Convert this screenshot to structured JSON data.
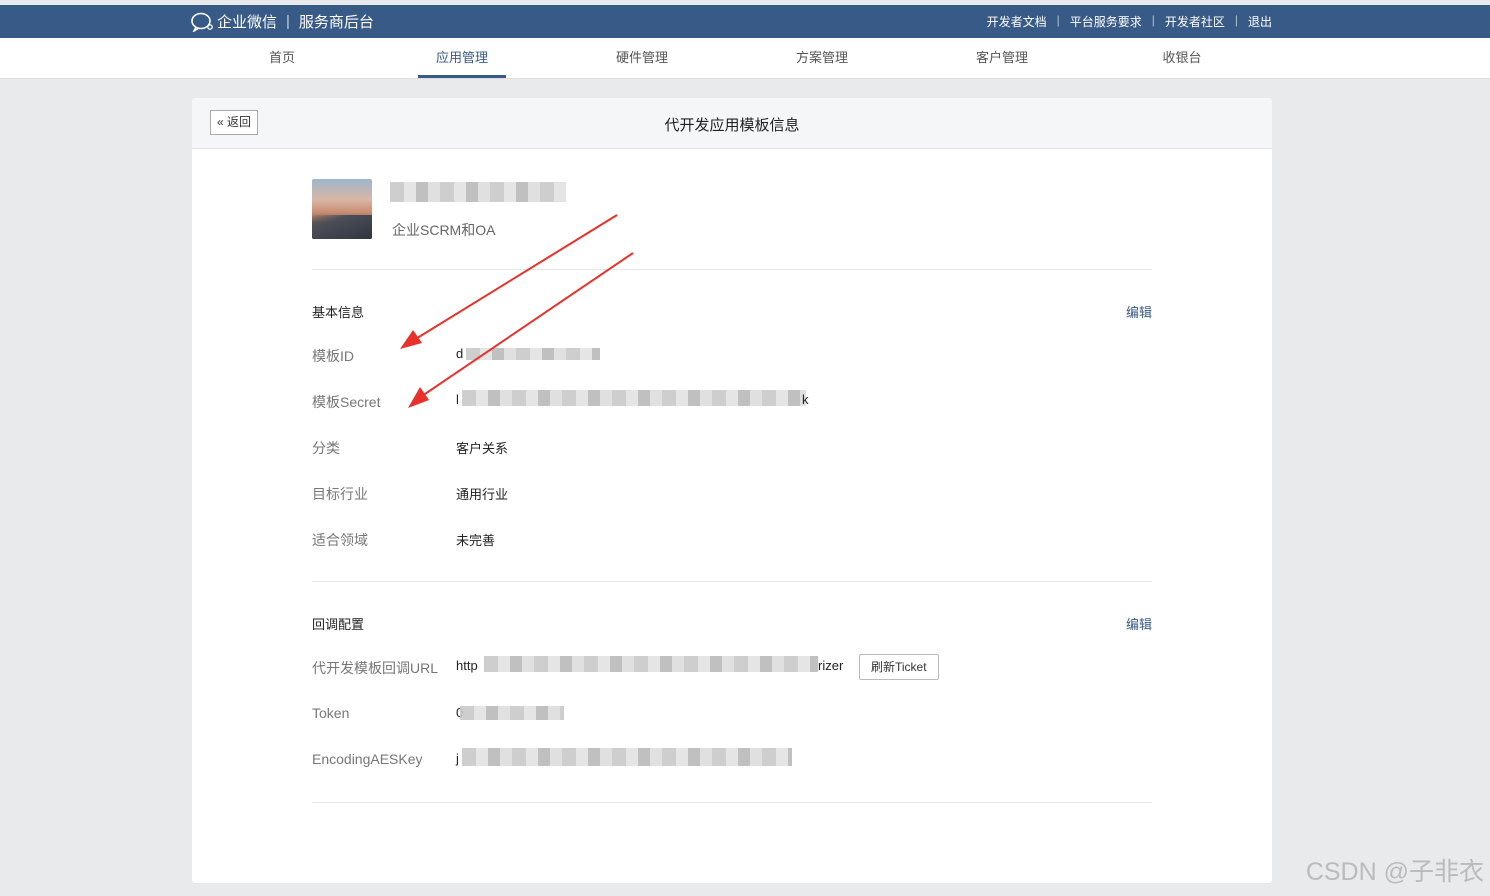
{
  "header": {
    "brand": "企业微信",
    "portal": "服务商后台",
    "links": [
      "开发者文档",
      "平台服务要求",
      "开发者社区",
      "退出"
    ]
  },
  "nav": {
    "items": [
      "首页",
      "应用管理",
      "硬件管理",
      "方案管理",
      "客户管理",
      "收银台"
    ],
    "active": "应用管理"
  },
  "page": {
    "back_label": "返回",
    "title": "代开发应用模板信息"
  },
  "app": {
    "subtitle": "企业SCRM和OA"
  },
  "basic_info": {
    "title": "基本信息",
    "edit_label": "编辑",
    "fields": [
      {
        "label": "模板ID",
        "value": "d"
      },
      {
        "label": "模板Secret",
        "value": "l"
      },
      {
        "label": "分类",
        "value": "客户关系"
      },
      {
        "label": "目标行业",
        "value": "通用行业"
      },
      {
        "label": "适合领域",
        "value": "未完善"
      }
    ]
  },
  "callback_config": {
    "title": "回调配置",
    "edit_label": "编辑",
    "fields": [
      {
        "label": "代开发模板回调URL",
        "value": "http"
      },
      {
        "label": "Token",
        "value": "0"
      },
      {
        "label": "EncodingAESKey",
        "value": "j"
      }
    ],
    "secret_tail": "k",
    "url_tail": "rizer",
    "refresh_button": "刷新Ticket"
  },
  "annotation_color": "#e8312a",
  "watermark": "CSDN @子非衣"
}
